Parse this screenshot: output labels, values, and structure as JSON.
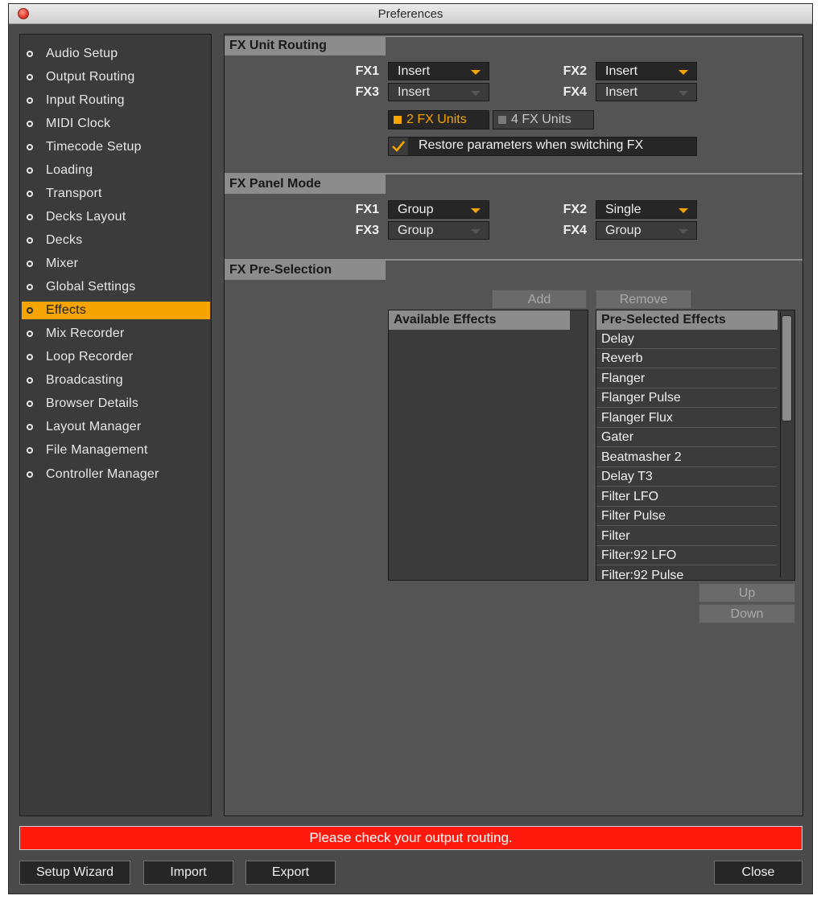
{
  "window": {
    "title": "Preferences"
  },
  "sidebar": {
    "items": [
      {
        "label": "Audio Setup"
      },
      {
        "label": "Output Routing"
      },
      {
        "label": "Input Routing"
      },
      {
        "label": "MIDI Clock"
      },
      {
        "label": "Timecode Setup"
      },
      {
        "label": "Loading"
      },
      {
        "label": "Transport"
      },
      {
        "label": "Decks Layout"
      },
      {
        "label": "Decks"
      },
      {
        "label": "Mixer"
      },
      {
        "label": "Global Settings"
      },
      {
        "label": "Effects",
        "active": true
      },
      {
        "label": "Mix Recorder"
      },
      {
        "label": "Loop Recorder"
      },
      {
        "label": "Broadcasting"
      },
      {
        "label": "Browser Details"
      },
      {
        "label": "Layout Manager"
      },
      {
        "label": "File Management"
      },
      {
        "label": "Controller Manager"
      }
    ]
  },
  "routing": {
    "header": "FX Unit Routing",
    "fx1_label": "FX1",
    "fx1_value": "Insert",
    "fx2_label": "FX2",
    "fx2_value": "Insert",
    "fx3_label": "FX3",
    "fx3_value": "Insert",
    "fx4_label": "FX4",
    "fx4_value": "Insert",
    "units_2_label": "2 FX Units",
    "units_4_label": "4 FX Units",
    "units_selected": "2 FX Units",
    "restore_label": "Restore parameters when switching FX",
    "restore_checked": true
  },
  "panel_mode": {
    "header": "FX Panel Mode",
    "fx1_label": "FX1",
    "fx1_value": "Group",
    "fx2_label": "FX2",
    "fx2_value": "Single",
    "fx3_label": "FX3",
    "fx3_value": "Group",
    "fx4_label": "FX4",
    "fx4_value": "Group"
  },
  "preselection": {
    "header": "FX Pre-Selection",
    "add_label": "Add",
    "remove_label": "Remove",
    "available_header": "Available Effects",
    "preselected_header": "Pre-Selected Effects",
    "preselected_items": [
      "Delay",
      "Reverb",
      "Flanger",
      "Flanger Pulse",
      "Flanger Flux",
      "Gater",
      "Beatmasher 2",
      "Delay T3",
      "Filter LFO",
      "Filter Pulse",
      "Filter",
      "Filter:92 LFO",
      "Filter:92 Pulse"
    ],
    "up_label": "Up",
    "down_label": "Down"
  },
  "status": {
    "message": "Please check your output routing."
  },
  "footer": {
    "setup_wizard_label": "Setup Wizard",
    "import_label": "Import",
    "export_label": "Export",
    "close_label": "Close"
  },
  "colors": {
    "accent": "#f5a400",
    "error": "#ff1a0d",
    "panel": "#545454",
    "sidebar": "#3b3b3b"
  }
}
